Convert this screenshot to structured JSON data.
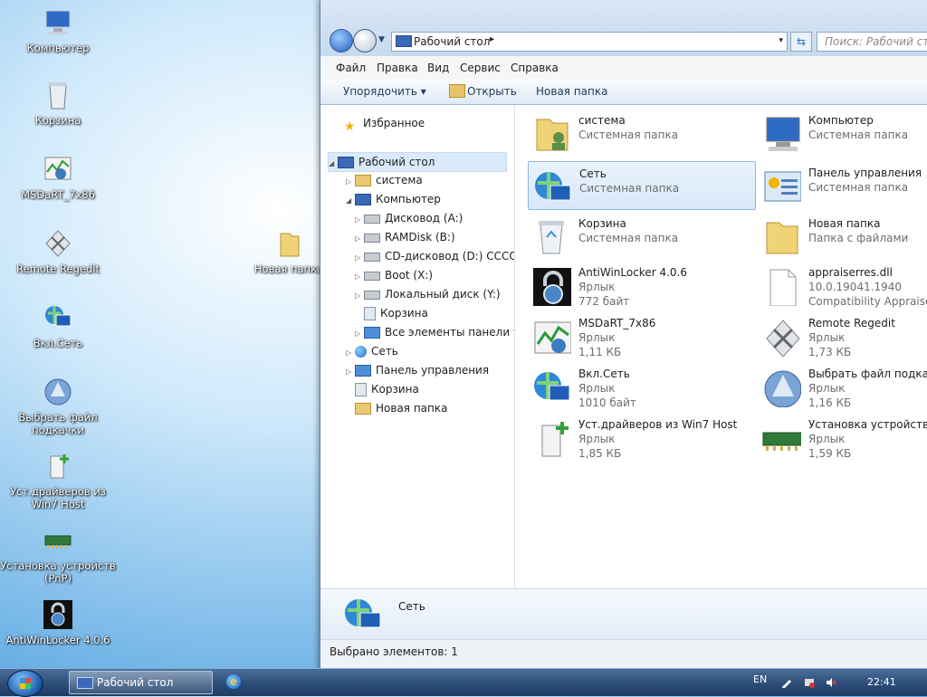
{
  "desktop": {
    "icons": [
      {
        "label": "Компьютер",
        "icon": "computer-icon"
      },
      {
        "label": "Корзина",
        "icon": "recycle-bin-icon"
      },
      {
        "label": "MSDaRT_7x86",
        "icon": "msdart-icon"
      },
      {
        "label": "Remote Regedit",
        "icon": "remote-regedit-icon"
      },
      {
        "label": "Вкл.Сеть",
        "icon": "network-icon"
      },
      {
        "label": "Выбрать файл подкачки",
        "icon": "pagefile-icon"
      },
      {
        "label": "Уст.драйверов из Win7 Host",
        "icon": "driver-install-icon"
      },
      {
        "label": "Установка устройств (PnP)",
        "icon": "pnp-icon"
      },
      {
        "label": "AntiWinLocker 4.0.6",
        "icon": "lock-icon"
      },
      {
        "label": "Новая папка",
        "icon": "folder-icon"
      }
    ]
  },
  "window": {
    "address": {
      "path": "Рабочий стол",
      "separator": "▸",
      "dropdown": "▾"
    },
    "search": {
      "placeholder": "Поиск: Рабочий стол"
    },
    "menu": [
      "Файл",
      "Правка",
      "Вид",
      "Сервис",
      "Справка"
    ],
    "toolbar": {
      "organize": "Упорядочить ▾",
      "open": "Открыть",
      "new_folder": "Новая папка"
    },
    "tree": [
      {
        "label": "Избранное",
        "icon": "star-icon"
      },
      {
        "label": "Рабочий стол",
        "icon": "desktop-icon"
      },
      {
        "label": "система",
        "icon": "user-folder-icon"
      },
      {
        "label": "Компьютер",
        "icon": "computer-icon"
      },
      {
        "label": "Дисковод (A:)",
        "icon": "floppy-icon"
      },
      {
        "label": "RAMDisk (B:)",
        "icon": "drive-icon"
      },
      {
        "label": "CD-дисковод (D:) CCCOMA",
        "icon": "cd-drive-icon"
      },
      {
        "label": "Boot (X:)",
        "icon": "drive-icon"
      },
      {
        "label": "Локальный диск (Y:)",
        "icon": "drive-icon"
      },
      {
        "label": "Корзина",
        "icon": "recycle-bin-icon"
      },
      {
        "label": "Все элементы панели упр",
        "icon": "control-panel-icon"
      },
      {
        "label": "Сеть",
        "icon": "network-icon"
      },
      {
        "label": "Панель управления",
        "icon": "control-panel-icon"
      },
      {
        "label": "Корзина",
        "icon": "recycle-bin-icon"
      },
      {
        "label": "Новая папка",
        "icon": "folder-icon"
      }
    ],
    "items": [
      {
        "name": "система",
        "l2": "Системная папка",
        "l3": ""
      },
      {
        "name": "Компьютер",
        "l2": "Системная папка",
        "l3": ""
      },
      {
        "name": "Сеть",
        "l2": "Системная папка",
        "l3": ""
      },
      {
        "name": "Панель управления",
        "l2": "Системная папка",
        "l3": ""
      },
      {
        "name": "Корзина",
        "l2": "Системная папка",
        "l3": ""
      },
      {
        "name": "Новая папка",
        "l2": "Папка с файлами",
        "l3": ""
      },
      {
        "name": "AntiWinLocker 4.0.6",
        "l2": "Ярлык",
        "l3": "772 байт"
      },
      {
        "name": "appraiserres.dll",
        "l2": "10.0.19041.1940",
        "l3": "Compatibility Appraiser S"
      },
      {
        "name": "MSDaRT_7x86",
        "l2": "Ярлык",
        "l3": "1,11 КБ"
      },
      {
        "name": "Remote Regedit",
        "l2": "Ярлык",
        "l3": "1,73 КБ"
      },
      {
        "name": "Вкл.Сеть",
        "l2": "Ярлык",
        "l3": "1010 байт"
      },
      {
        "name": "Выбрать файл подкачки",
        "l2": "Ярлык",
        "l3": "1,16 КБ"
      },
      {
        "name": "Уст.драйверов из Win7 Host",
        "l2": "Ярлык",
        "l3": "1,85 КБ"
      },
      {
        "name": "Установка устройств (Pn",
        "l2": "Ярлык",
        "l3": "1,59 КБ"
      }
    ],
    "details": {
      "name": "Сеть"
    },
    "status": "Выбрано элементов: 1"
  },
  "taskbar": {
    "task_label": "Рабочий стол",
    "ie_glyph": "e",
    "lang": "EN",
    "clock": "22:41"
  },
  "colors": {
    "selection": "#dbeaf8",
    "taskbar": "#2c4d78"
  }
}
